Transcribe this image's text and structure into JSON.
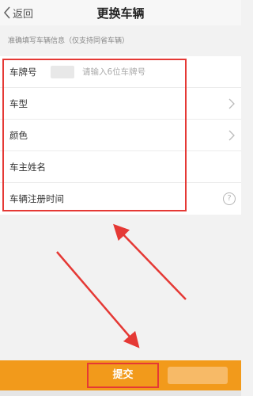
{
  "nav": {
    "back_label": "返回",
    "title": "更换车辆"
  },
  "notice": "准确填写车辆信息（仅支持同省车辆）",
  "form": {
    "plate": {
      "label": "车牌号",
      "placeholder": "请输入6位车牌号"
    },
    "model": {
      "label": "车型"
    },
    "color": {
      "label": "颜色"
    },
    "owner": {
      "label": "车主姓名"
    },
    "reg_date": {
      "label": "车辆注册时间",
      "help_icon": "?"
    }
  },
  "submit": {
    "label": "提交"
  },
  "colors": {
    "accent": "#f29a1b",
    "annotation": "#e53935"
  }
}
